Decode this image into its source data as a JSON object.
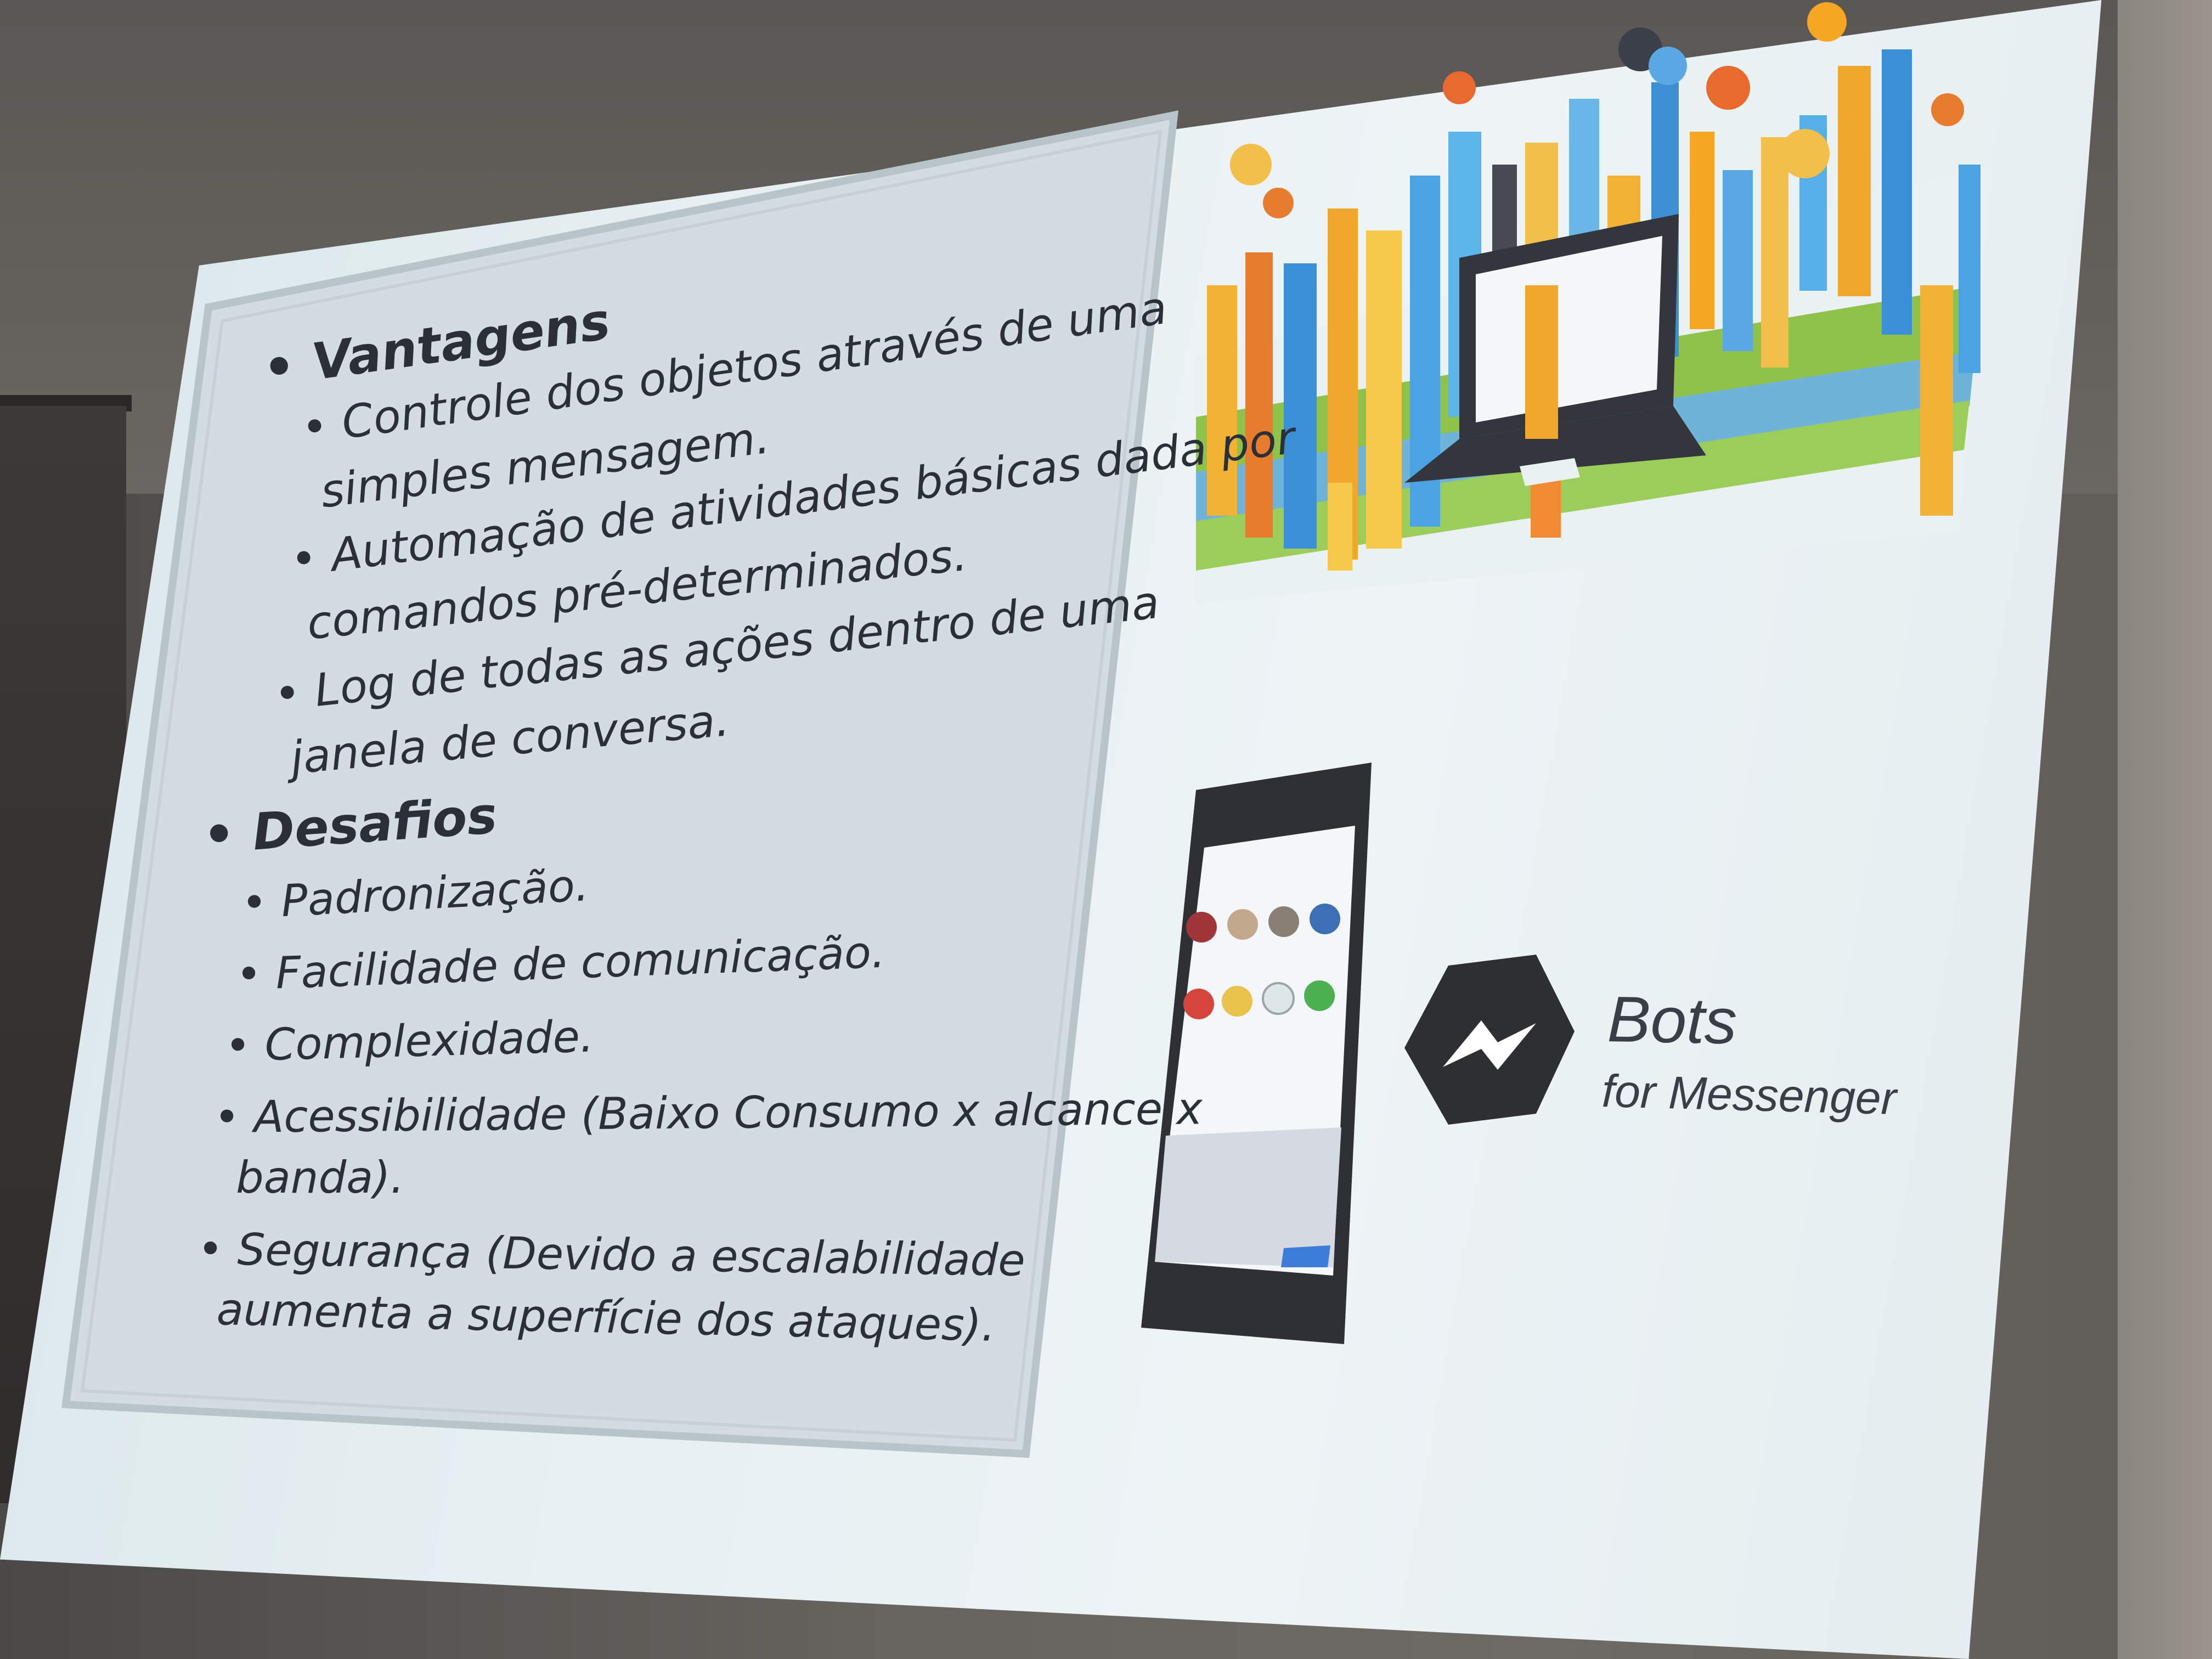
{
  "slide": {
    "heading_advantages": "Vantagens",
    "advantages": [
      [
        "Controle dos objetos através de uma",
        "simples mensagem."
      ],
      [
        "Automação de atividades básicas dada por",
        "comandos pré-determinados."
      ],
      [
        "Log de todas as ações dentro de uma",
        "janela de conversa."
      ]
    ],
    "heading_challenges": "Desafios",
    "challenges": [
      [
        "Padronização."
      ],
      [
        "Facilidade de comunicação."
      ],
      [
        "Complexidade."
      ],
      [
        "Acessibilidade (Baixo Consumo x alcance x",
        "banda)."
      ],
      [
        "Segurança (Devido a escalabilidade",
        "aumenta a superfície dos ataques)."
      ]
    ],
    "bullet": "•"
  },
  "brand": {
    "title": "Bots",
    "subtitle": "for Messenger"
  },
  "colors": {
    "text": "#2a2f38",
    "screen": "#e6eff2",
    "textbox": "#d6e0e3",
    "brand_dark": "#2d2f33"
  }
}
